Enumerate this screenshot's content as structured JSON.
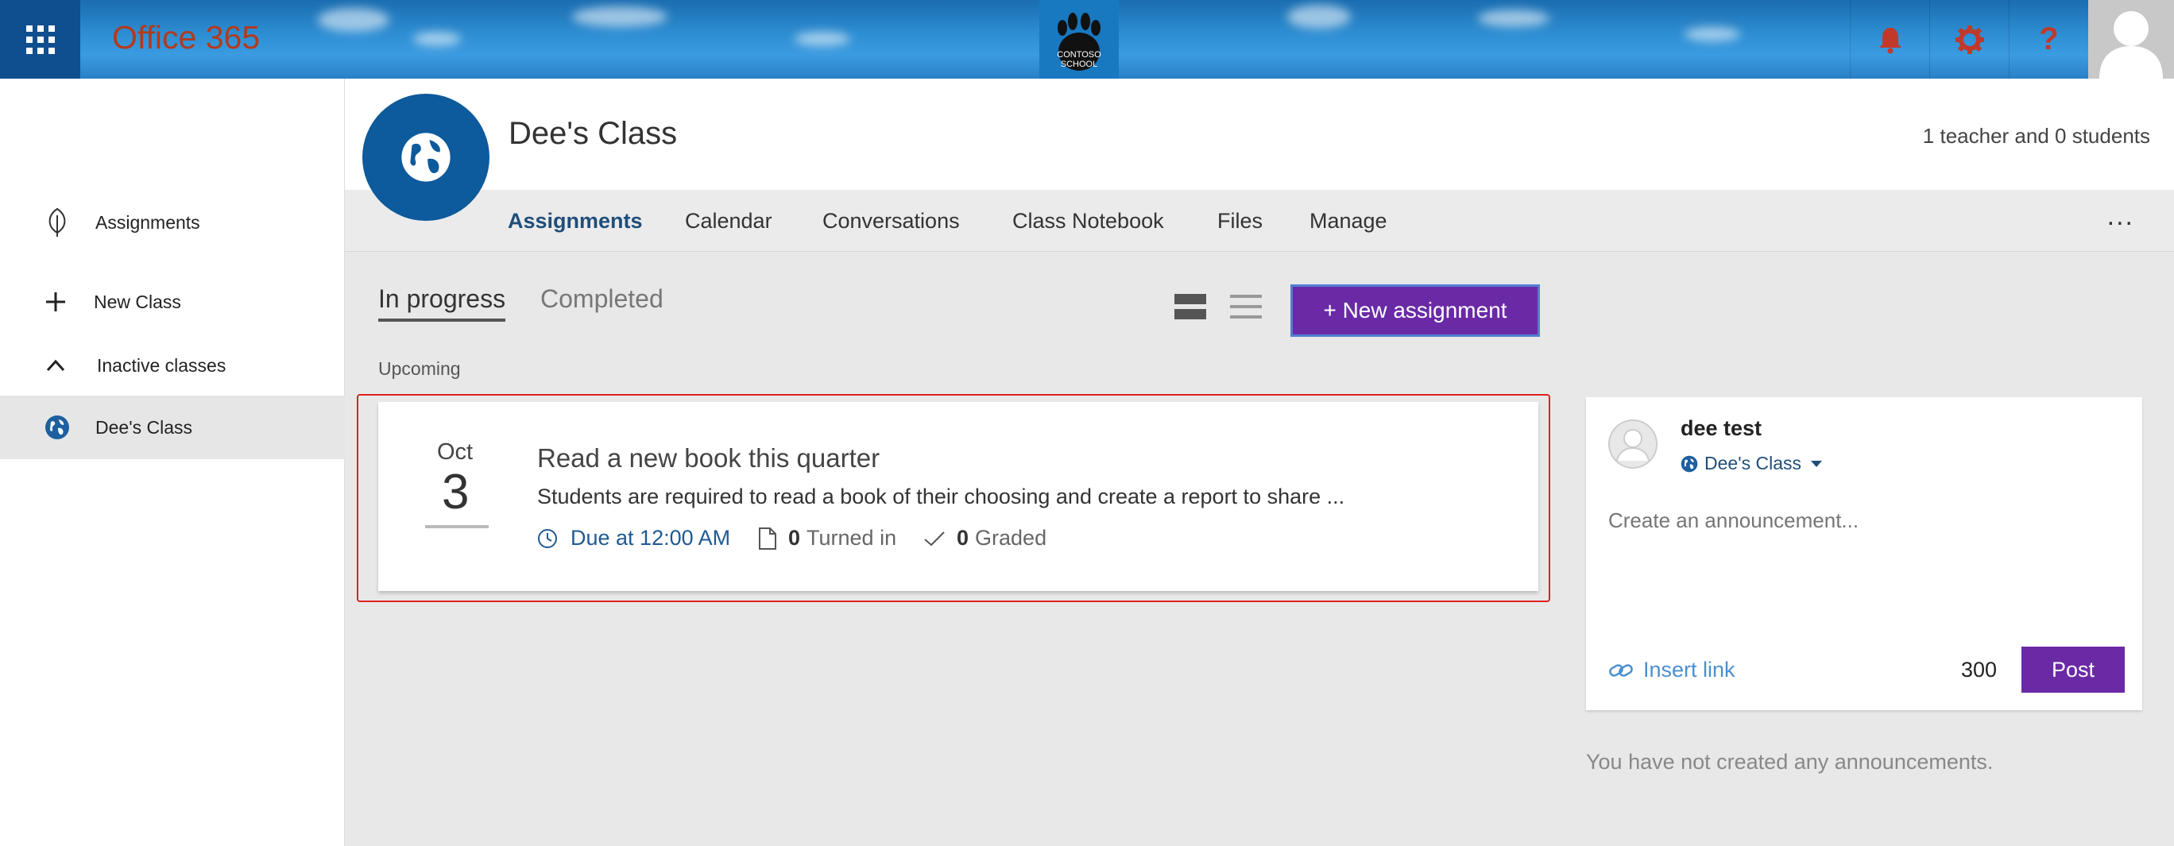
{
  "topbar": {
    "brand": "Office 365",
    "logo_text": "CONTOSO SCHOOL",
    "icons": [
      "waffle-icon",
      "bell-icon",
      "gear-icon",
      "help-icon",
      "avatar-icon"
    ],
    "colors": {
      "bell": "#c0392b",
      "gear": "#c0392b",
      "help": "#c0392b",
      "brand": "#b23a1e",
      "bar": "#2a86cc"
    }
  },
  "sidebar": {
    "items": [
      {
        "label": "Assignments",
        "icon": "leaf-icon"
      },
      {
        "label": "New Class",
        "icon": "plus-icon"
      },
      {
        "label": "Inactive classes",
        "icon": "chevron-up-icon"
      },
      {
        "label": "Dee's Class",
        "icon": "globe-icon"
      }
    ]
  },
  "class": {
    "title": "Dee's Class",
    "members": "1 teacher and 0 students",
    "tabs": [
      "Assignments",
      "Calendar",
      "Conversations",
      "Class Notebook",
      "Files",
      "Manage"
    ],
    "more": "..."
  },
  "assignments": {
    "subtabs": [
      "In progress",
      "Completed"
    ],
    "new_button": "+  New assignment",
    "section": "Upcoming",
    "card": {
      "month": "Oct",
      "day": "3",
      "title": "Read a new book this quarter",
      "description": "Students are required to read a book of their choosing and create a report to share ...",
      "due": "Due at 12:00 AM",
      "turned_in_count": "0",
      "turned_in_label": "Turned in",
      "graded_count": "0",
      "graded_label": "Graded"
    }
  },
  "announcement": {
    "user": "dee test",
    "class": "Dee's Class",
    "placeholder": "Create an announcement...",
    "insert_link": "Insert link",
    "char_count": "300",
    "post": "Post",
    "empty": "You have not created any announcements."
  },
  "colors": {
    "accent": "#6a2aa6",
    "nav_blue": "#1f4e79",
    "class_circle": "#0d5a9c",
    "highlight": "#dd2222"
  }
}
